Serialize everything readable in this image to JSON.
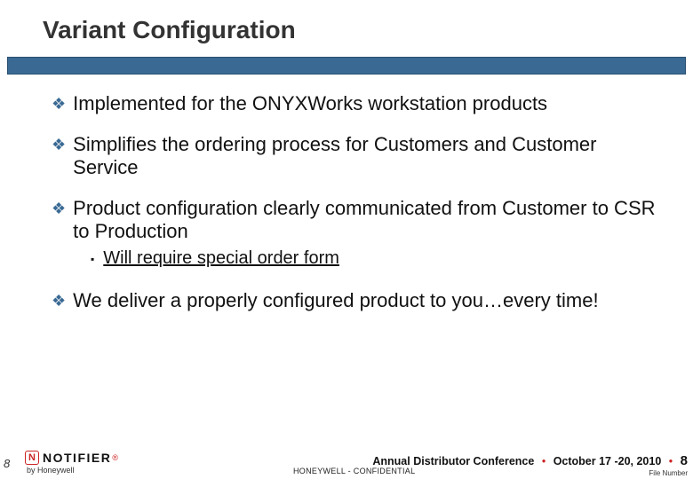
{
  "title": "Variant Configuration",
  "bullets": [
    {
      "text": "Implemented for the ONYXWorks workstation products"
    },
    {
      "text": "Simplifies the ordering process for Customers and Customer Service"
    },
    {
      "text": "Product configuration clearly communicated from Customer to CSR to Production",
      "sub": "Will require special order form"
    },
    {
      "text": "We deliver a properly configured product to you…every time!"
    }
  ],
  "footer": {
    "page_left": "8",
    "logo_word": "NOTIFIER",
    "logo_reg": "®",
    "logo_sub": "by Honeywell",
    "confidential": "HONEYWELL -  CONFIDENTIAL",
    "conference": "Annual Distributor Conference",
    "date": "October 17 -20, 2010",
    "page_right": "8",
    "filenum": "File Number"
  }
}
